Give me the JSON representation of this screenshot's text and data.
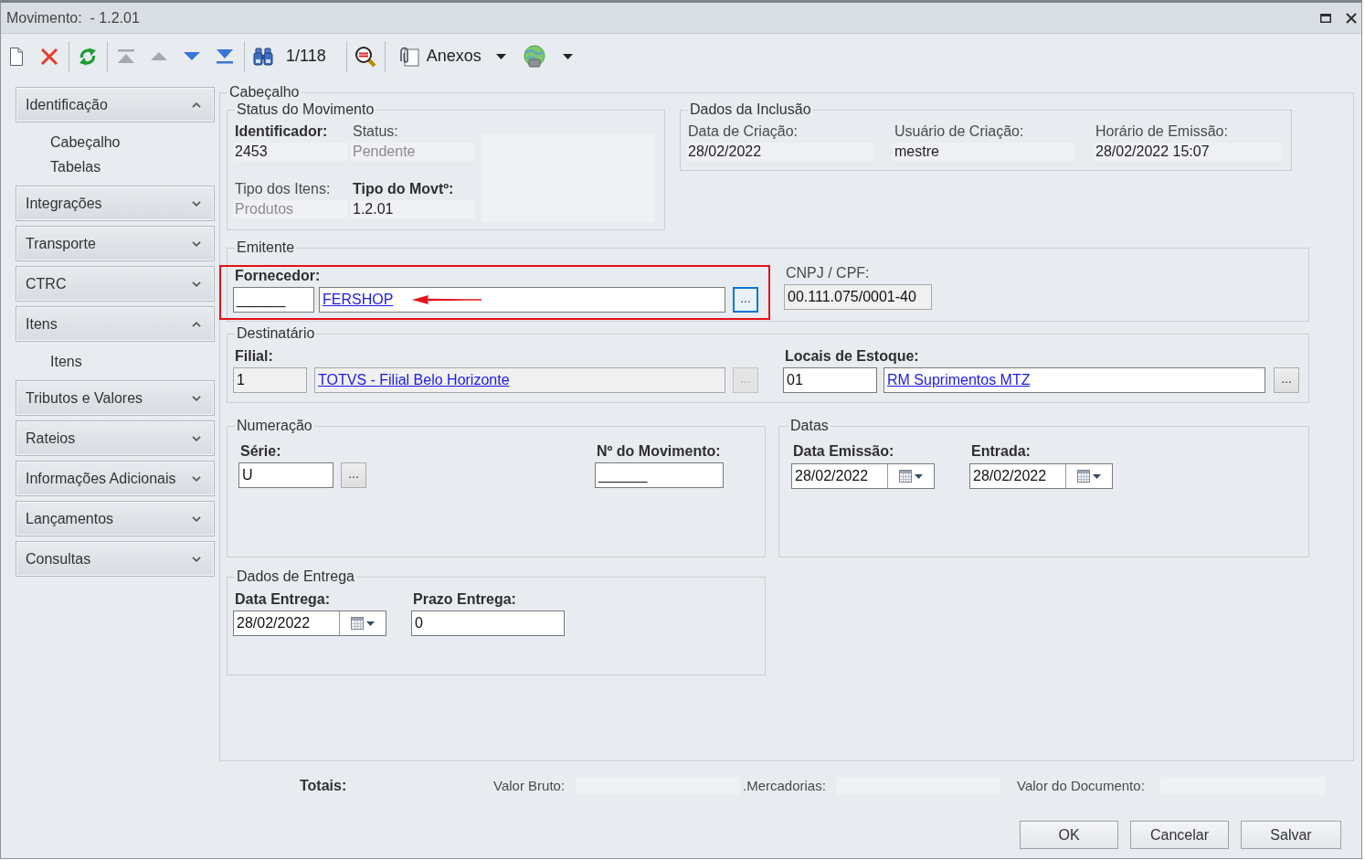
{
  "window": {
    "title": "Movimento:  - 1.2.01"
  },
  "toolbar": {
    "groups": [
      [
        {
          "kind": "new",
          "disabled": false
        },
        {
          "kind": "delete",
          "disabled": false
        }
      ],
      [
        {
          "kind": "refresh",
          "disabled": false
        }
      ],
      [
        {
          "kind": "first",
          "disabled": true
        },
        {
          "kind": "previous",
          "disabled": true
        },
        {
          "kind": "next",
          "disabled": false
        },
        {
          "kind": "last",
          "disabled": false
        }
      ],
      [
        {
          "kind": "find",
          "disabled": false
        },
        {
          "kind": "counter",
          "text": "1/118",
          "disabled": false
        }
      ],
      [
        {
          "kind": "sql",
          "disabled": false
        }
      ],
      [
        {
          "kind": "attachments",
          "label": "Anexos",
          "disabled": false
        },
        {
          "kind": "menu",
          "disabled": false
        },
        {
          "kind": "globe",
          "disabled": false
        },
        {
          "kind": "menu",
          "disabled": false
        }
      ]
    ]
  },
  "sidebar": {
    "groups": [
      {
        "label": "Identificação",
        "expanded": true,
        "items": [
          "Cabeçalho",
          "Tabelas"
        ]
      },
      {
        "label": "Integrações",
        "expanded": false
      },
      {
        "label": "Transporte",
        "expanded": false
      },
      {
        "label": "CTRC",
        "expanded": false
      },
      {
        "label": "Itens",
        "expanded": true,
        "items": [
          "Itens"
        ]
      },
      {
        "label": "Tributos e Valores",
        "expanded": false
      },
      {
        "label": "Rateios",
        "expanded": false
      },
      {
        "label": "Informações Adicionais",
        "expanded": false
      },
      {
        "label": "Lançamentos",
        "expanded": false
      },
      {
        "label": "Consultas",
        "expanded": false
      }
    ]
  },
  "cabecalho": {
    "title": "Cabeçalho",
    "status_do_movimento": {
      "title": "Status do Movimento",
      "fields": [
        {
          "label": "Identificador:",
          "required": true,
          "value": "2453",
          "disabled": false
        },
        {
          "label": "Status:",
          "required": false,
          "value": "Pendente",
          "disabled": true
        },
        {
          "label": "Tipo dos Itens:",
          "required": false,
          "value": "Produtos",
          "disabled": true
        },
        {
          "label": "Tipo do Movtº:",
          "required": true,
          "value": "1.2.01",
          "disabled": false
        }
      ]
    },
    "dados_da_inclusao": {
      "title": "Dados da Inclusão",
      "fields": [
        {
          "label": "Data de Criação:",
          "value": "28/02/2022"
        },
        {
          "label": "Usuário de Criação:",
          "value": "mestre"
        },
        {
          "label": "Horário de Emissão:",
          "value": "28/02/2022 15:07"
        }
      ]
    },
    "emitente": {
      "title": "Emitente",
      "fornecedor": {
        "label": "Fornecedor:",
        "required": true,
        "disabled": false,
        "code": "______",
        "name": "FERSHOP",
        "button": {
          "text": "...",
          "focused": true,
          "disabled": false
        },
        "highlighted": true
      },
      "cnpj_cpf": {
        "label": "CNPJ / CPF:",
        "required": false,
        "value": "00.111.075/0001-40",
        "disabled": true
      }
    },
    "destinatario": {
      "title": "Destinatário",
      "filial": {
        "label": "Filial:",
        "required": true,
        "disabled": true,
        "code": "1",
        "name": "TOTVS - Filial Belo Horizonte",
        "button": {
          "text": "...",
          "focused": false,
          "disabled": true
        }
      },
      "locais_de_estoque": {
        "label": "Locais de Estoque:",
        "required": true,
        "disabled": false,
        "code": "01",
        "name": "RM Suprimentos MTZ",
        "button": {
          "text": "...",
          "focused": false,
          "disabled": false
        }
      }
    },
    "numeracao": {
      "title": "Numeração",
      "serie": {
        "label": "Série:",
        "required": true,
        "disabled": false,
        "value": "U",
        "button": {
          "text": "...",
          "focused": false,
          "disabled": false
        }
      },
      "numero": {
        "label": "Nº do Movimento:",
        "required": true,
        "disabled": false,
        "value": "______"
      }
    },
    "datas": {
      "title": "Datas",
      "fields": [
        {
          "label": "Data Emissão:",
          "required": true,
          "value": "28/02/2022"
        },
        {
          "label": "Entrada:",
          "required": true,
          "value": "28/02/2022"
        }
      ]
    },
    "dados_de_entrega": {
      "title": "Dados de Entrega",
      "data_entrega": {
        "label": "Data Entrega:",
        "required": true,
        "value": "28/02/2022"
      },
      "prazo_entrega": {
        "label": "Prazo Entrega:",
        "required": true,
        "disabled": false,
        "value": "0"
      }
    }
  },
  "totais": {
    "label": "Totais:",
    "fields": [
      "Valor Bruto:",
      ".Mercadorias:",
      "Valor do Documento:"
    ]
  },
  "buttons": [
    "OK",
    "Cancelar",
    "Salvar"
  ]
}
